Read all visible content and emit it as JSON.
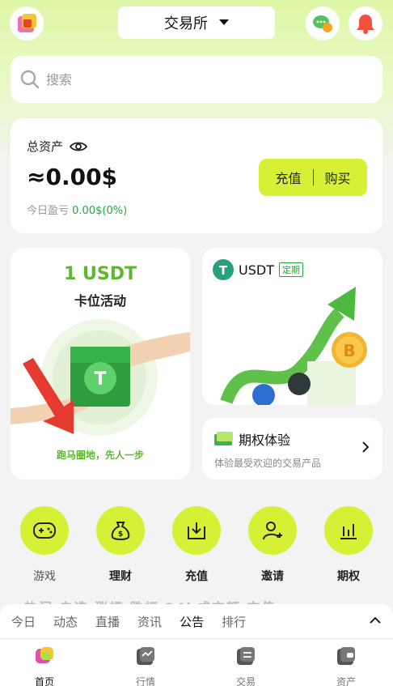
{
  "header": {
    "exchange_label": "交易所"
  },
  "search": {
    "placeholder": "搜索"
  },
  "assets": {
    "label": "总资产",
    "value": "≈0.00$",
    "pnl_label": "今日盈亏",
    "pnl_value": "0.00$(0%)",
    "deposit_label": "充值",
    "buy_label": "购买"
  },
  "promo_left": {
    "title": "1 USDT",
    "subtitle": "卡位活动",
    "caption": "跑马圈地，先人一步"
  },
  "promo_right": {
    "coin": "USDT",
    "tag": "定期"
  },
  "options": {
    "title": "期权体验",
    "subtitle": "体验最受欢迎的交易产品"
  },
  "quick_actions": [
    {
      "label": "游戏"
    },
    {
      "label": "理财"
    },
    {
      "label": "充值"
    },
    {
      "label": "邀请"
    },
    {
      "label": "期权"
    }
  ],
  "faded_tabs": "热门   自选   涨幅   跌幅   24h成交额   市值",
  "news_tabs": [
    {
      "label": "今日"
    },
    {
      "label": "动态"
    },
    {
      "label": "直播"
    },
    {
      "label": "资讯"
    },
    {
      "label": "公告"
    },
    {
      "label": "排行"
    }
  ],
  "news_active": "公告",
  "bottom_nav": [
    {
      "label": "首页"
    },
    {
      "label": "行情"
    },
    {
      "label": "交易"
    },
    {
      "label": "资产"
    }
  ],
  "colors": {
    "accent": "#d6f135",
    "green": "#22a53a",
    "promo_green": "#5cb82f"
  }
}
